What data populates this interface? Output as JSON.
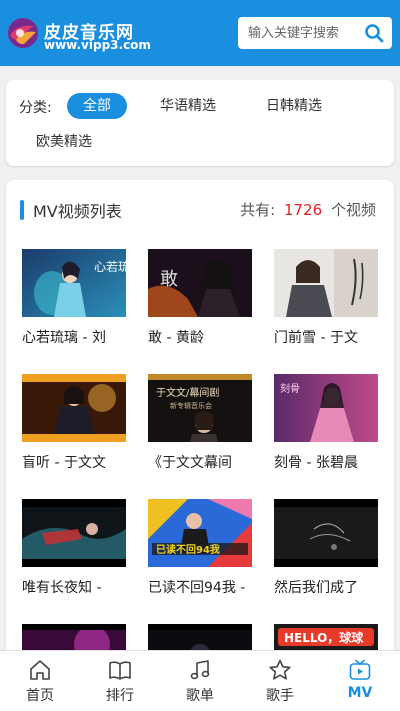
{
  "header": {
    "site_name": "皮皮音乐网",
    "site_url": "www.vipp3.com",
    "search_placeholder": "输入关键字搜索",
    "brand_color": "#1a8fe0"
  },
  "categories": {
    "label": "分类:",
    "items": [
      {
        "label": "全部",
        "active": true
      },
      {
        "label": "华语精选",
        "active": false
      },
      {
        "label": "日韩精选",
        "active": false
      },
      {
        "label": "欧美精选",
        "active": false
      }
    ]
  },
  "mv_list": {
    "title": "MV视频列表",
    "count_prefix": "共有:",
    "count": "1726",
    "count_suffix": "个视频",
    "count_color": "#e52222",
    "items": [
      {
        "title": "心若琉璃 - 刘"
      },
      {
        "title": "敢 - 黄龄"
      },
      {
        "title": "门前雪 - 于文"
      },
      {
        "title": "盲听 - 于文文"
      },
      {
        "title": "《于文文幕间"
      },
      {
        "title": "刻骨 - 张碧晨"
      },
      {
        "title": "唯有长夜知 -"
      },
      {
        "title": "已读不回94我 -"
      },
      {
        "title": "然后我们成了"
      },
      {
        "title": ""
      },
      {
        "title": ""
      },
      {
        "title": ""
      }
    ],
    "thumb_texts": {
      "t1": "心若琉璃",
      "t2": "敢",
      "t5a": "于文文/幕间剧",
      "t5b": "新专辑音乐会",
      "t6": "刻骨",
      "t8": "已读不回94我",
      "t12": "HELLO，球球"
    }
  },
  "bottom_nav": {
    "items": [
      {
        "label": "首页",
        "icon": "home-icon",
        "active": false
      },
      {
        "label": "排行",
        "icon": "book-icon",
        "active": false
      },
      {
        "label": "歌单",
        "icon": "music-note-icon",
        "active": false
      },
      {
        "label": "歌手",
        "icon": "star-icon",
        "active": false
      },
      {
        "label": "MV",
        "icon": "tv-icon",
        "active": true
      }
    ]
  }
}
